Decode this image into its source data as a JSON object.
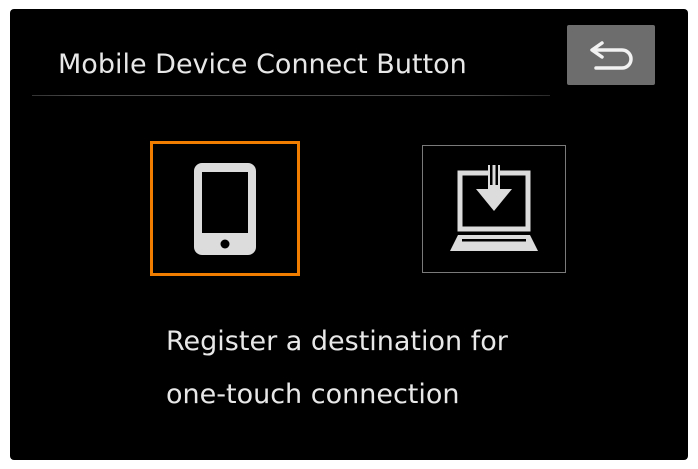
{
  "header": {
    "title": "Mobile Device Connect Button"
  },
  "back_button": {
    "icon": "return-arrow-icon"
  },
  "options": [
    {
      "name": "smartphone",
      "icon": "smartphone-icon",
      "selected": true
    },
    {
      "name": "computer",
      "icon": "computer-download-icon",
      "selected": false
    }
  ],
  "description": {
    "line1": "Register a destination for",
    "line2": "one-touch connection"
  },
  "colors": {
    "background": "#000000",
    "selection_border": "#f07d00",
    "button_bg": "#6d6d6d",
    "icon": "#dcdcdc"
  }
}
